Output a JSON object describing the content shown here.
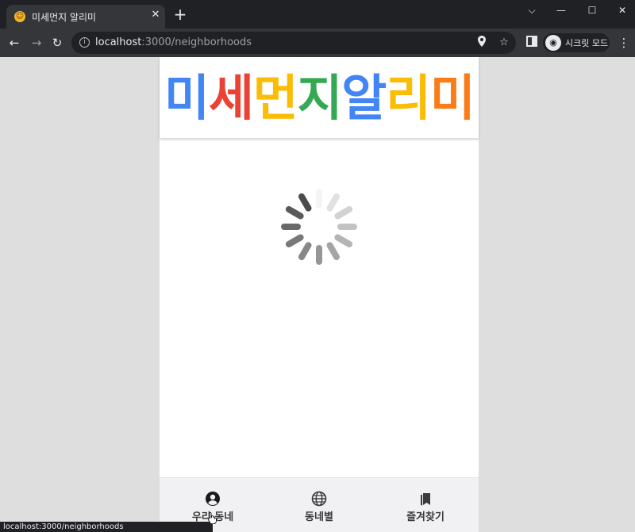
{
  "browser": {
    "tab_title": "미세먼지 알리미",
    "new_tab_symbol": "+",
    "url_host": "localhost",
    "url_path": ":3000/neighborhoods",
    "profile_label": "시크릿 모드",
    "status_url": "localhost:3000/neighborhoods"
  },
  "app": {
    "logo_chars": [
      {
        "char": "미",
        "color": "#4285f4"
      },
      {
        "char": "세",
        "color": "#ea4335"
      },
      {
        "char": "먼",
        "color": "#fbbc05"
      },
      {
        "char": "지",
        "color": "#34a853"
      },
      {
        "char": "알",
        "color": "#4285f4"
      },
      {
        "char": "리",
        "color": "#fbbc05"
      },
      {
        "char": "미",
        "color": "#fa7b17"
      }
    ],
    "loading": true,
    "nav": [
      {
        "label": "우리 동네",
        "icon": "user-circle-icon"
      },
      {
        "label": "동네별",
        "icon": "globe-icon"
      },
      {
        "label": "즐겨찾기",
        "icon": "bookmarks-icon"
      }
    ]
  }
}
